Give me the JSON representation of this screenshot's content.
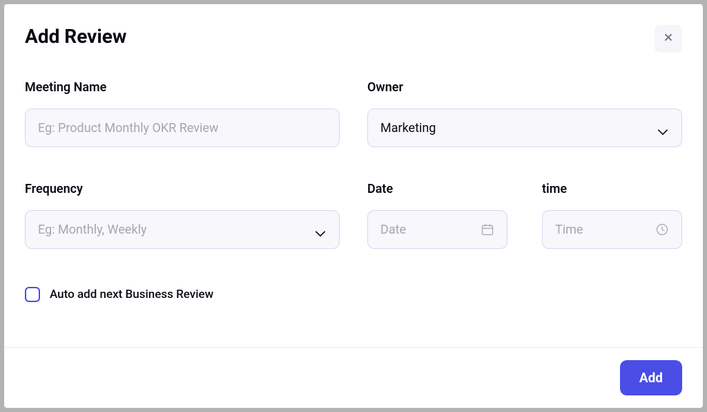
{
  "header": {
    "title": "Add Review"
  },
  "form": {
    "meetingName": {
      "label": "Meeting Name",
      "placeholder": "Eg: Product Monthly OKR Review",
      "value": ""
    },
    "owner": {
      "label": "Owner",
      "value": "Marketing"
    },
    "frequency": {
      "label": "Frequency",
      "placeholder": "Eg: Monthly, Weekly",
      "value": ""
    },
    "date": {
      "label": "Date",
      "placeholder": "Date",
      "value": ""
    },
    "time": {
      "label": "time",
      "placeholder": "Time",
      "value": ""
    },
    "autoAdd": {
      "label": "Auto add next Business Review",
      "checked": false
    }
  },
  "footer": {
    "addButton": "Add"
  }
}
